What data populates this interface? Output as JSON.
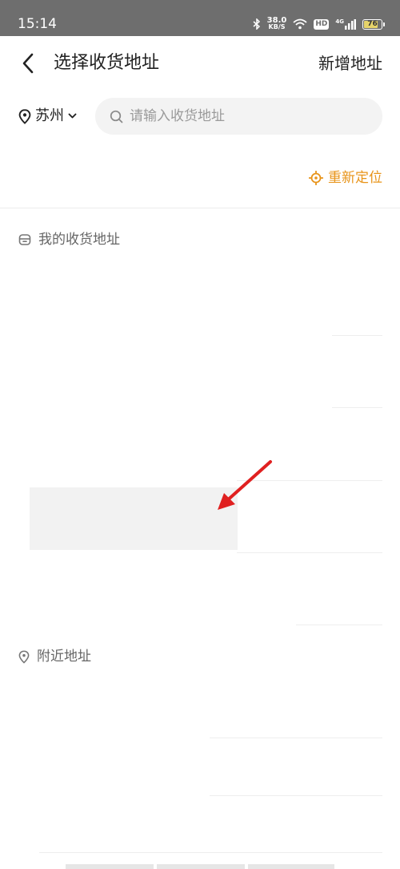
{
  "status_bar": {
    "time": "15:14",
    "net_speed_value": "38.0",
    "net_speed_unit": "KB/S",
    "hd_label": "HD",
    "signal_label": "4G",
    "battery_level": "76",
    "icons": [
      "bluetooth-icon",
      "wifi-icon",
      "hd-icon",
      "signal-icon",
      "battery-icon"
    ]
  },
  "header": {
    "title": "选择收货地址",
    "add_label": "新增地址"
  },
  "search": {
    "city": "苏州",
    "placeholder": "请输入收货地址"
  },
  "relocate": {
    "label": "重新定位",
    "color": "#e8941a"
  },
  "sections": {
    "my_addresses": {
      "title": "我的收货地址"
    },
    "nearby": {
      "title": "附近地址"
    }
  },
  "annotation": {
    "arrow_color": "#e02020"
  }
}
